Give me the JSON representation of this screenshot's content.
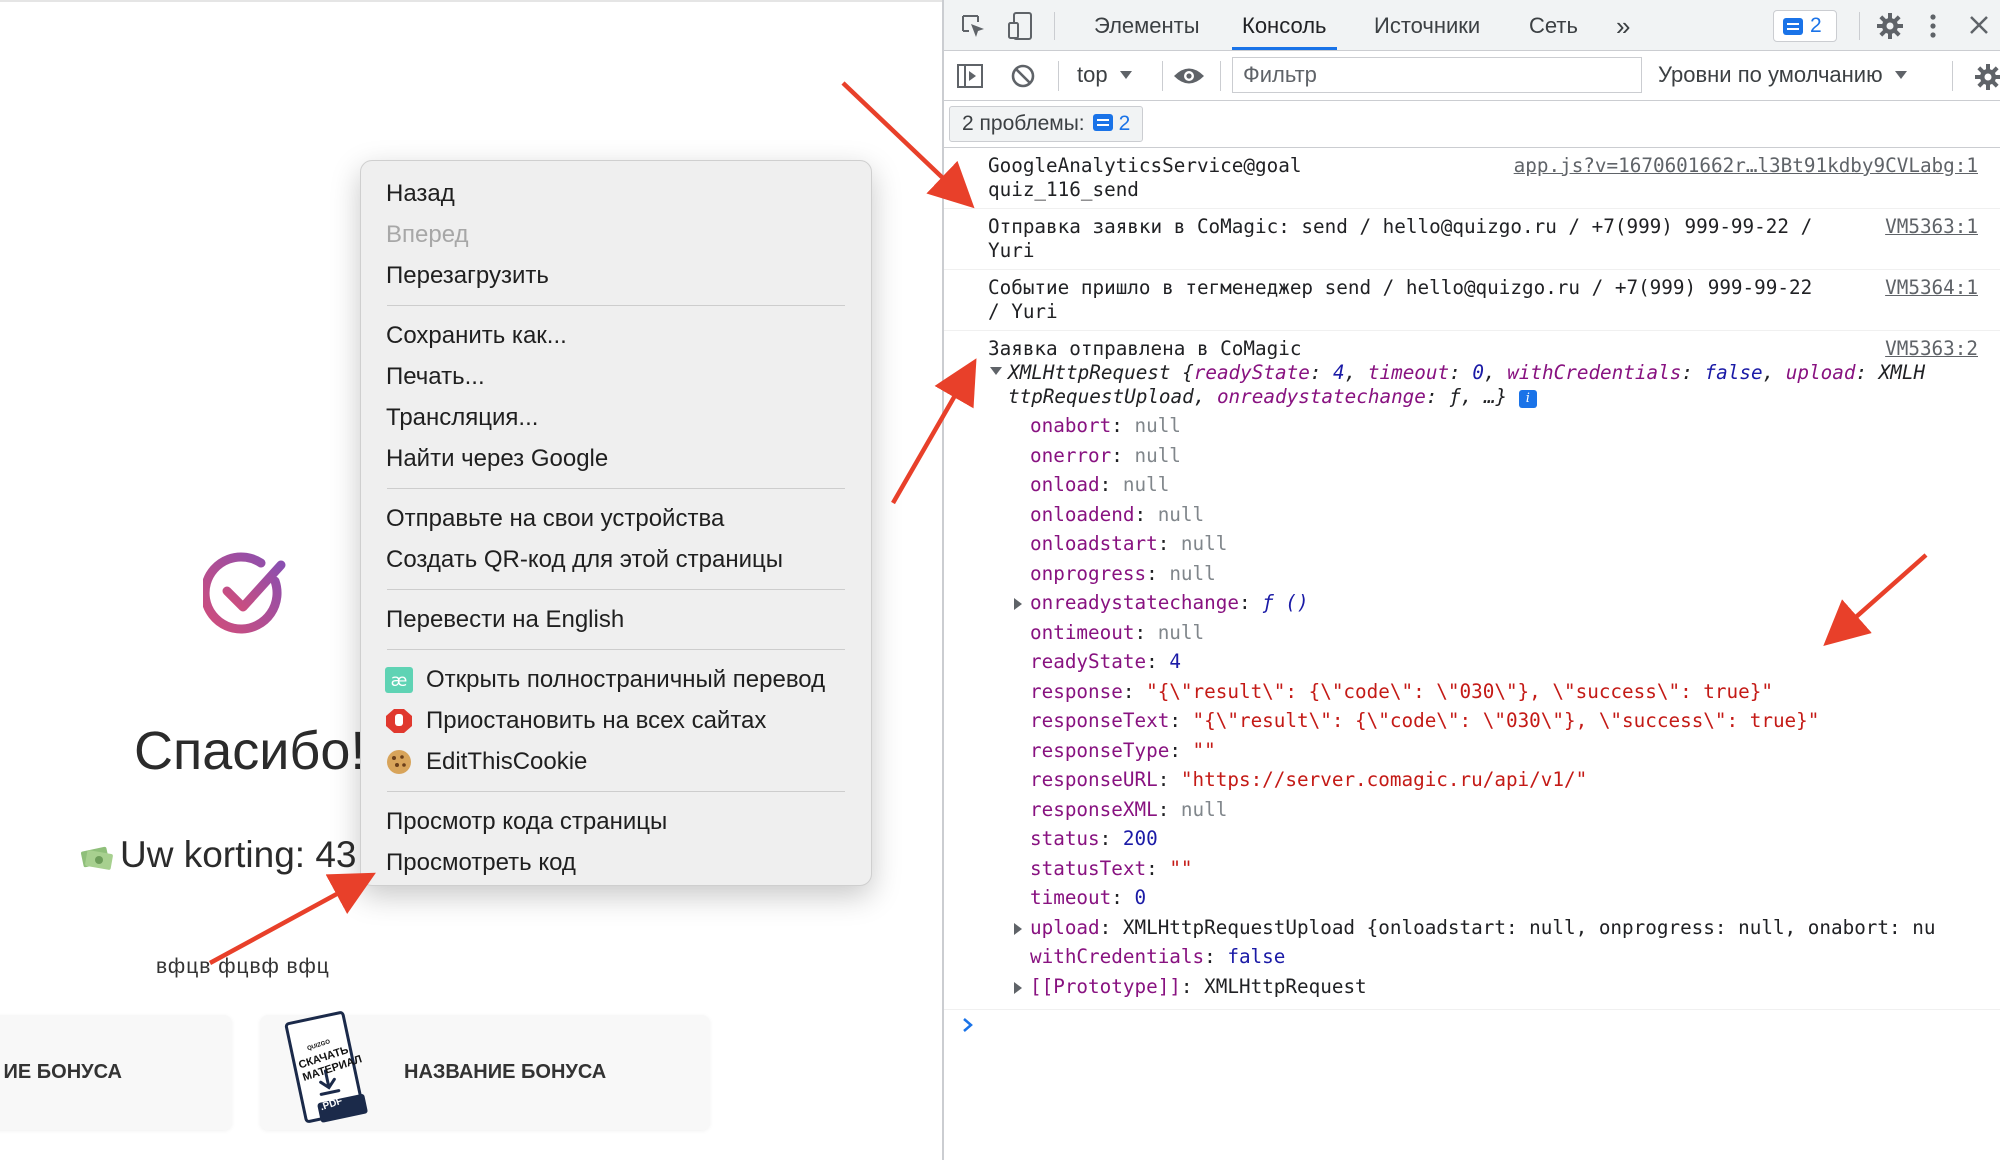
{
  "page": {
    "thanks": "Спасибо!",
    "discount": "Uw korting: 43",
    "small_text": "вфцв фцвф вфц",
    "bonus_cards": [
      {
        "label": "ИЕ БОНУСА"
      },
      {
        "label": "НАЗВАНИЕ БОНУСА",
        "pdf_top": "СКАЧАТЬ МАТЕРИАЛ",
        "pdf_small": "QUIZGO",
        "pdf_ext": ".PDF"
      }
    ],
    "accent_color": "#c2497f"
  },
  "context_menu": {
    "groups": [
      [
        {
          "label": "Назад",
          "enabled": true
        },
        {
          "label": "Вперед",
          "enabled": false
        },
        {
          "label": "Перезагрузить",
          "enabled": true
        }
      ],
      [
        {
          "label": "Сохранить как...",
          "enabled": true
        },
        {
          "label": "Печать...",
          "enabled": true
        },
        {
          "label": "Трансляция...",
          "enabled": true
        },
        {
          "label": "Найти через Google",
          "enabled": true
        }
      ],
      [
        {
          "label": "Отправьте на свои устройства",
          "enabled": true
        },
        {
          "label": "Создать QR-код для этой страницы",
          "enabled": true
        }
      ],
      [
        {
          "label": "Перевести на English",
          "enabled": true
        }
      ],
      [
        {
          "label": "Открыть полностраничный перевод",
          "icon": "translate-extension-icon"
        },
        {
          "label": "Приостановить на всех сайтах",
          "icon": "stop-hand-icon"
        },
        {
          "label": "EditThisCookie",
          "icon": "cookie-icon"
        }
      ],
      [
        {
          "label": "Просмотр кода страницы",
          "enabled": true
        },
        {
          "label": "Просмотреть код",
          "enabled": true
        }
      ]
    ]
  },
  "devtools": {
    "tabs": [
      "Элементы",
      "Консоль",
      "Источники",
      "Сеть"
    ],
    "active_tab": "Консоль",
    "more_tabs": "»",
    "issues_badge_count": "2",
    "context": "top",
    "filter_placeholder": "Фильтр",
    "levels": "Уровни по умолчанию",
    "issues_label": "2 проблемы:",
    "issues_count": "2",
    "console": {
      "entries": [
        {
          "text": "GoogleAnalyticsService@goal\nquiz_116_send",
          "source": "app.js?v=1670601662r…l3Bt91kdby9CVLabg:1"
        },
        {
          "text": "Отправка заявки в CoMagic: send / hello@quizgo.ru / +7(999) 999-99-22 /\nYuri",
          "source": "VM5363:1"
        },
        {
          "text": "Событие пришло в тегменеджер send / hello@quizgo.ru / +7(999) 999-99-22\n/ Yuri",
          "source": "VM5364:1"
        },
        {
          "text": "Заявка отправлена в CoMagic",
          "source": "VM5363:2"
        }
      ],
      "object_summary_1": "XMLHttpRequest {",
      "object_summary_2": "ttpRequestUpload, ",
      "props": {
        "onabort": "null",
        "onerror": "null",
        "onload": "null",
        "onloadend": "null",
        "onloadstart": "null",
        "onprogress": "null",
        "onreadystatechange": "ƒ ()",
        "ontimeout": "null",
        "readyState": "4",
        "response": "\"{\\\"result\\\": {\\\"code\\\": \\\"030\\\"}, \\\"success\\\": true}\"",
        "responseText": "\"{\\\"result\\\": {\\\"code\\\": \\\"030\\\"}, \\\"success\\\": true}\"",
        "responseType": "\"\"",
        "responseURL": "\"https://server.comagic.ru/api/v1/\"",
        "responseXML": "null",
        "status": "200",
        "statusText": "\"\"",
        "timeout": "0",
        "upload": "XMLHttpRequestUpload {onloadstart: null, onprogress: null, onabort: nu",
        "withCredentials": "false",
        "prototype": "XMLHttpRequest"
      }
    }
  }
}
